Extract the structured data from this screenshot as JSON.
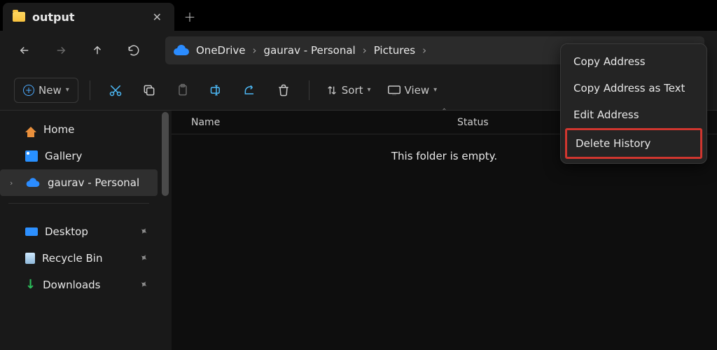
{
  "tab": {
    "title": "output"
  },
  "breadcrumb": {
    "root": "OneDrive",
    "user": "gaurav - Personal",
    "folder": "Pictures"
  },
  "toolbar": {
    "new_label": "New",
    "sort_label": "Sort",
    "view_label": "View"
  },
  "sidebar": {
    "home": "Home",
    "gallery": "Gallery",
    "personal": "gaurav - Personal",
    "desktop": "Desktop",
    "recycle": "Recycle Bin",
    "downloads": "Downloads"
  },
  "columns": {
    "name": "Name",
    "status": "Status"
  },
  "content": {
    "empty_message": "This folder is empty."
  },
  "context_menu": {
    "copy_address": "Copy Address",
    "copy_address_text": "Copy Address as Text",
    "edit_address": "Edit Address",
    "delete_history": "Delete History"
  }
}
